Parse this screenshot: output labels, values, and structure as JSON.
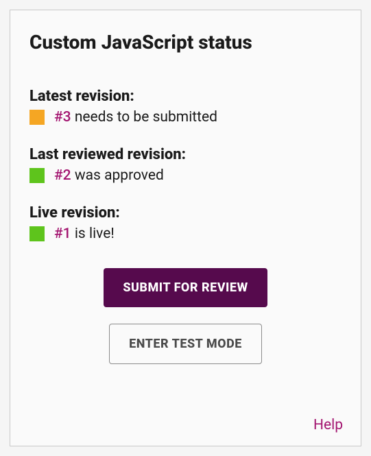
{
  "panel": {
    "title": "Custom JavaScript status"
  },
  "revisions": {
    "latest": {
      "heading": "Latest revision:",
      "number": "#3",
      "status_text": " needs to be submitted",
      "swatch_color": "#f5a623"
    },
    "last_reviewed": {
      "heading": "Last reviewed revision:",
      "number": "#2",
      "status_text": " was approved",
      "swatch_color": "#5ec41c"
    },
    "live": {
      "heading": "Live revision:",
      "number": "#1",
      "status_text": " is live!",
      "swatch_color": "#5ec41c"
    }
  },
  "buttons": {
    "submit": "Submit for review",
    "test_mode": "Enter test mode"
  },
  "help_link": "Help"
}
